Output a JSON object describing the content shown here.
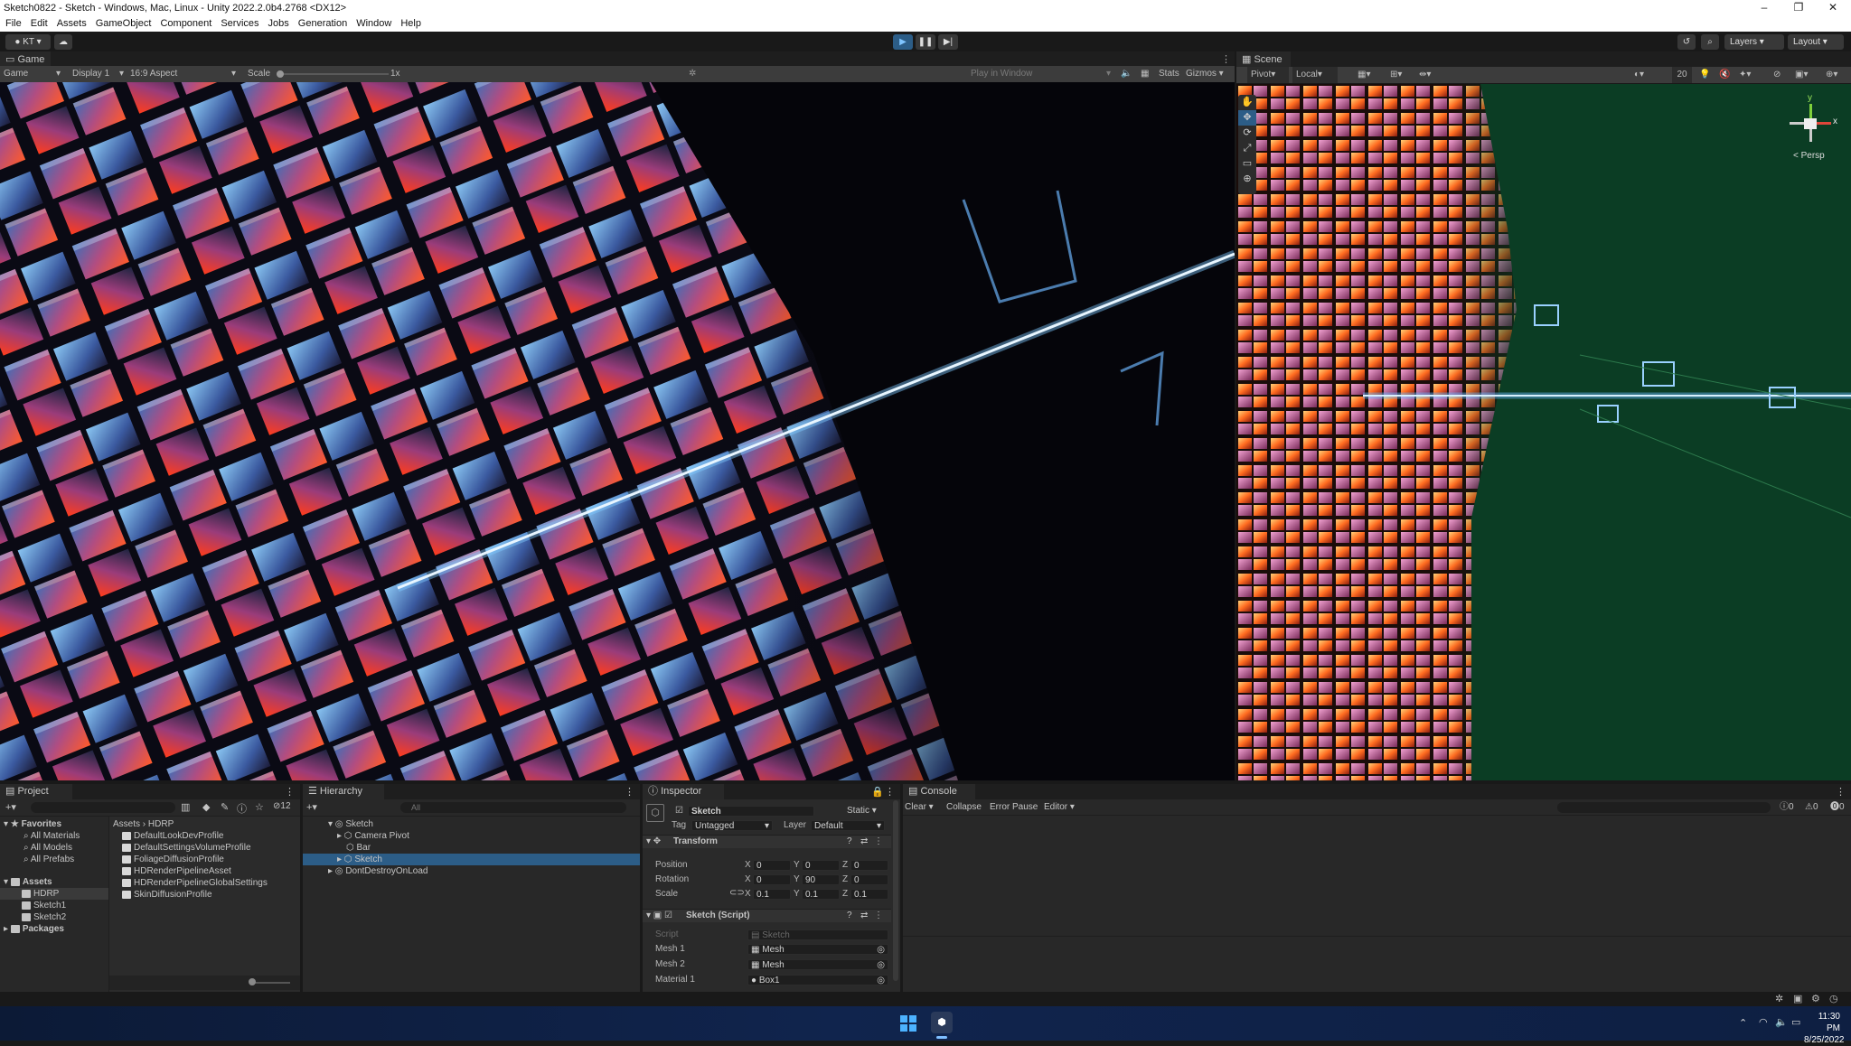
{
  "window": {
    "title": "Sketch0822 - Sketch - Windows, Mac, Linux - Unity 2022.2.0b4.2768 <DX12>"
  },
  "menu": [
    "File",
    "Edit",
    "Assets",
    "GameObject",
    "Component",
    "Services",
    "Jobs",
    "Generation",
    "Window",
    "Help"
  ],
  "toolbar": {
    "account": "KT",
    "layers": "Layers",
    "layout": "Layout"
  },
  "game": {
    "tab": "Game",
    "mode": "Game",
    "display": "Display 1",
    "aspect": "16:9 Aspect",
    "scale_label": "Scale",
    "scale_value": "1x",
    "play_mode": "Play in Window",
    "stats": "Stats",
    "gizmos": "Gizmos"
  },
  "scene": {
    "tab": "Scene",
    "pivot": "Pivot",
    "local": "Local",
    "grid_size": "20",
    "persp": "< Persp",
    "gizmo_y": "y",
    "gizmo_x": "x"
  },
  "project": {
    "tab": "Project",
    "count": "12",
    "favorites": "Favorites",
    "favorite_items": [
      "All Materials",
      "All Models",
      "All Prefabs"
    ],
    "assets": "Assets",
    "asset_folders": [
      "HDRP",
      "Sketch1",
      "Sketch2"
    ],
    "packages": "Packages",
    "breadcrumb_root": "Assets",
    "breadcrumb_leaf": "HDRP",
    "files": [
      "DefaultLookDevProfile",
      "DefaultSettingsVolumeProfile",
      "FoliageDiffusionProfile",
      "HDRenderPipelineAsset",
      "HDRenderPipelineGlobalSettings",
      "SkinDiffusionProfile"
    ]
  },
  "hierarchy": {
    "tab": "Hierarchy",
    "search_placeholder": "All",
    "scene": "Sketch",
    "children": [
      "Camera Pivot",
      "Bar",
      "Sketch"
    ],
    "dontdestroy": "DontDestroyOnLoad"
  },
  "inspector": {
    "tab": "Inspector",
    "object_name": "Sketch",
    "static_label": "Static",
    "tag_label": "Tag",
    "tag_value": "Untagged",
    "layer_label": "Layer",
    "layer_value": "Default",
    "transform": {
      "title": "Transform",
      "position_label": "Position",
      "position": [
        "0",
        "0",
        "0"
      ],
      "rotation_label": "Rotation",
      "rotation": [
        "0",
        "90",
        "0"
      ],
      "scale_label": "Scale",
      "scale": [
        "0.1",
        "0.1",
        "0.1"
      ]
    },
    "script_component": {
      "title": "Sketch (Script)",
      "script_label": "Script",
      "script_value": "Sketch",
      "mesh1_label": "Mesh 1",
      "mesh1_value": "Mesh",
      "mesh2_label": "Mesh 2",
      "mesh2_value": "Mesh",
      "material1_label": "Material 1",
      "material1_value": "Box1"
    }
  },
  "console": {
    "tab": "Console",
    "clear": "Clear",
    "collapse": "Collapse",
    "error_pause": "Error Pause",
    "editor": "Editor",
    "counts": [
      "0",
      "0",
      "0"
    ]
  },
  "taskbar": {
    "time": "11:30 PM",
    "date": "8/25/2022"
  },
  "colors": {
    "accent": "#2c5d87",
    "play_active": "#4b9cd3",
    "scene_bg": "#0b3d24"
  }
}
